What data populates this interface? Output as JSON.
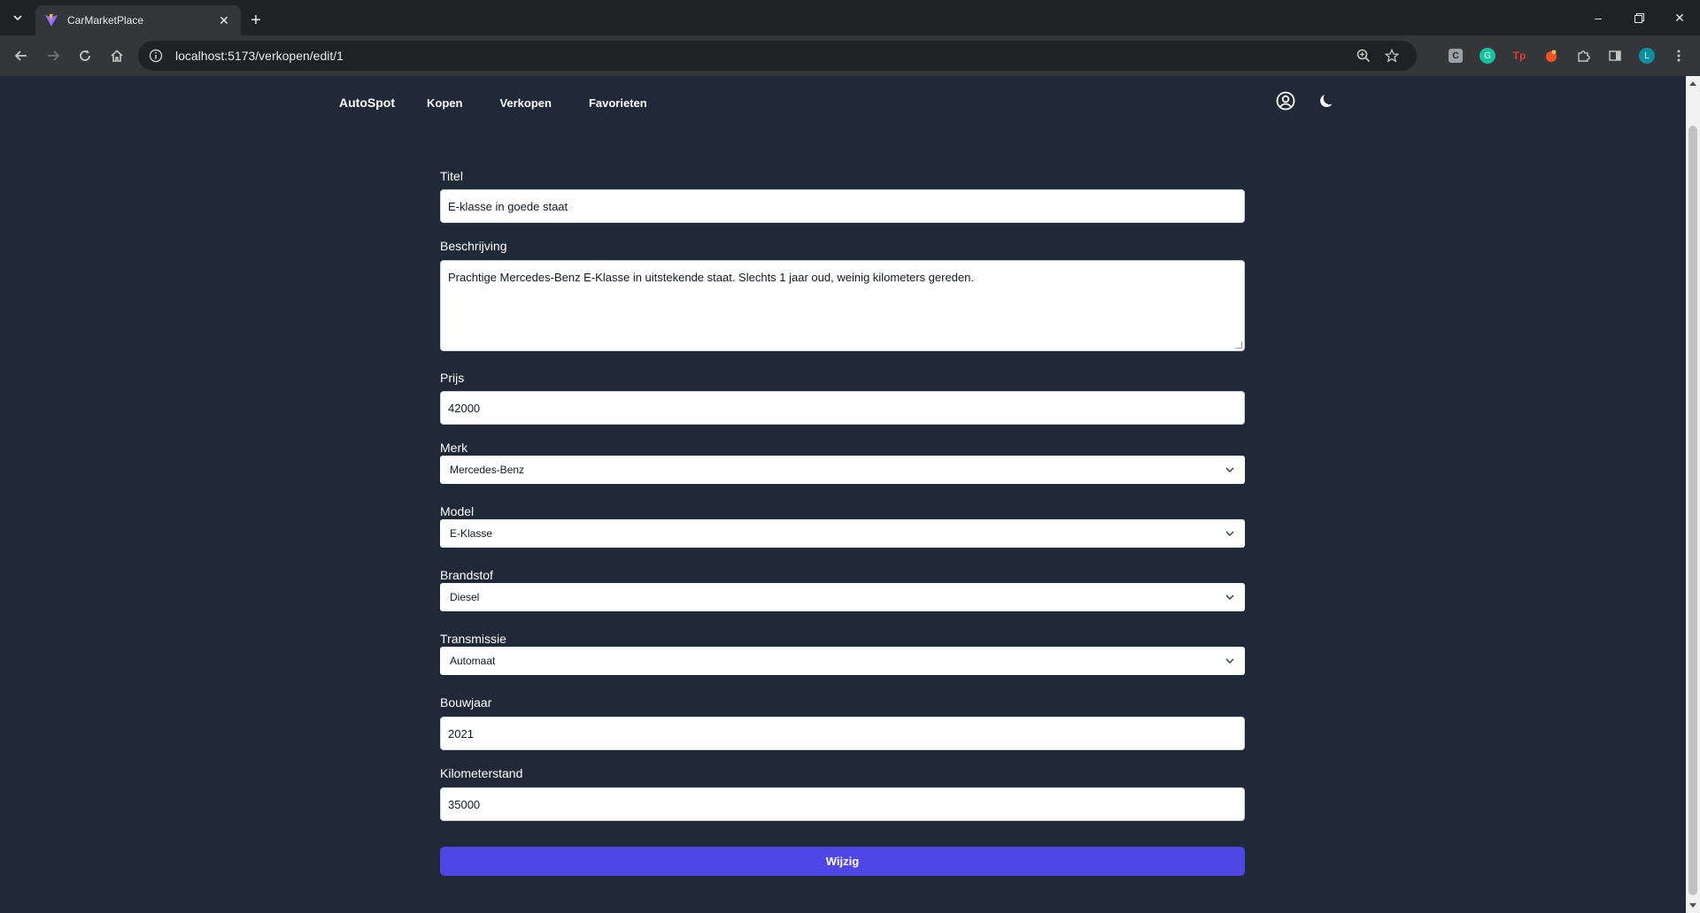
{
  "browser": {
    "tab_title": "CarMarketPlace",
    "url": "localhost:5173/verkopen/edit/1",
    "ext_c": "C",
    "ext_g": "G",
    "ext_tp": "Tp",
    "profile_initial": "L",
    "colors": {
      "ext_grammarly": "#15c39a",
      "ext_tp": "#e53935",
      "ext_orange": "#f4511e",
      "profile": "#0b8fa3"
    }
  },
  "nav": {
    "brand": "AutoSpot",
    "links": [
      "Kopen",
      "Verkopen",
      "Favorieten"
    ]
  },
  "form": {
    "titel": {
      "label": "Titel",
      "value": "E-klasse in goede staat"
    },
    "beschrijving": {
      "label": "Beschrijving",
      "value": "Prachtige Mercedes-Benz E-Klasse in uitstekende staat. Slechts 1 jaar oud, weinig kilometers gereden."
    },
    "prijs": {
      "label": "Prijs",
      "value": "42000"
    },
    "merk": {
      "label": "Merk",
      "value": "Mercedes-Benz"
    },
    "model": {
      "label": "Model",
      "value": "E-Klasse"
    },
    "brandstof": {
      "label": "Brandstof",
      "value": "Diesel"
    },
    "transmissie": {
      "label": "Transmissie",
      "value": "Automaat"
    },
    "bouwjaar": {
      "label": "Bouwjaar",
      "value": "2021"
    },
    "kilometerstand": {
      "label": "Kilometerstand",
      "value": "35000"
    },
    "submit_label": "Wijzig"
  },
  "colors": {
    "page_bg": "#1f2937",
    "accent": "#4f46e5"
  }
}
